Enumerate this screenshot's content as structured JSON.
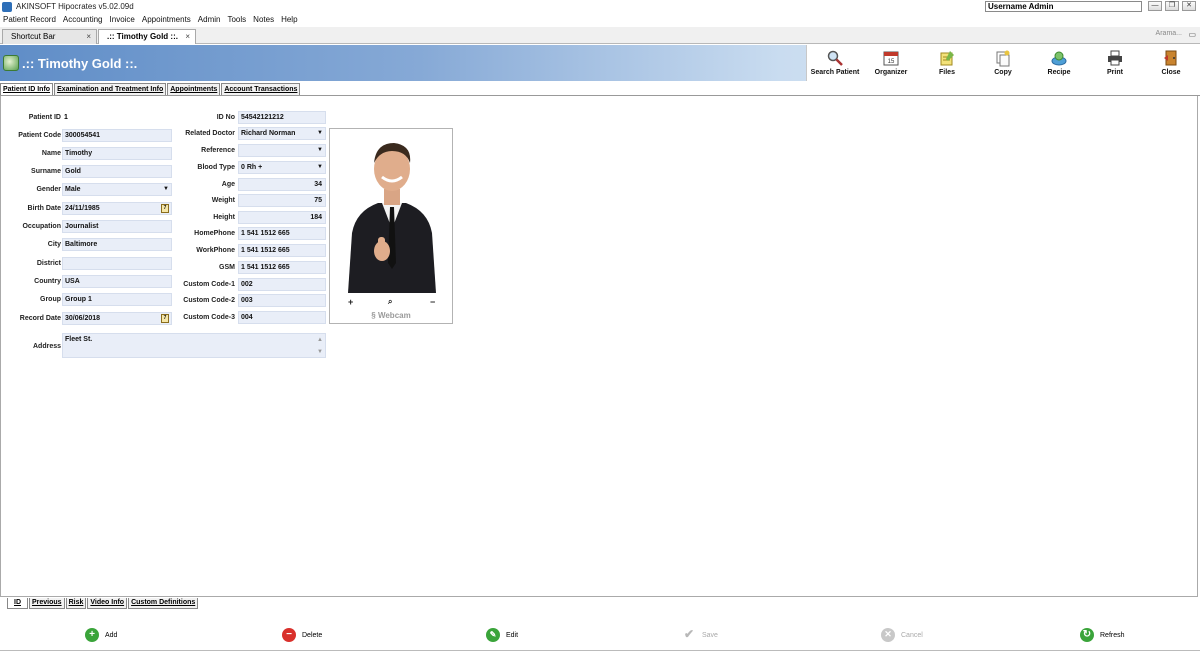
{
  "window": {
    "title": "AKINSOFT Hipocrates v5.02.09d",
    "user": "Username Admin",
    "controls": {
      "minimize": "—",
      "restore": "❐",
      "close": "✕"
    }
  },
  "menu": [
    "Patient Record",
    "Accounting",
    "Invoice",
    "Appointments",
    "Admin",
    "Tools",
    "Notes",
    "Help"
  ],
  "doc_tabs": [
    {
      "label": "Shortcut Bar",
      "close": "×"
    },
    {
      "label": ".:: Timothy Gold ::.",
      "close": "×"
    }
  ],
  "search_hint": "Arama...",
  "header": {
    "title": ".:: Timothy Gold ::."
  },
  "toolbar": [
    "Search Patient",
    "Organizer",
    "Files",
    "Copy",
    "Recipe",
    "Print",
    "Close"
  ],
  "section_tabs": [
    "Patient ID Info",
    "Examination and Treatment Info",
    "Appointments",
    "Account Transactions"
  ],
  "left_fields": {
    "patient_id": {
      "label": "Patient ID",
      "value": "1"
    },
    "patient_code": {
      "label": "Patient Code",
      "value": "300054541"
    },
    "name": {
      "label": "Name",
      "value": "Timothy"
    },
    "surname": {
      "label": "Surname",
      "value": "Gold"
    },
    "gender": {
      "label": "Gender",
      "value": "Male"
    },
    "birth_date": {
      "label": "Birth Date",
      "value": "24/11/1985"
    },
    "occupation": {
      "label": "Occupation",
      "value": "Journalist"
    },
    "city": {
      "label": "City",
      "value": "Baltimore"
    },
    "district": {
      "label": "District",
      "value": ""
    },
    "country": {
      "label": "Country",
      "value": "USA"
    },
    "group": {
      "label": "Group",
      "value": "Group 1"
    },
    "record_date": {
      "label": "Record Date",
      "value": "30/06/2018"
    },
    "address": {
      "label": "Address",
      "value": "Fleet St."
    }
  },
  "right_fields": {
    "id_no": {
      "label": "ID No",
      "value": "54542121212"
    },
    "related_doctor": {
      "label": "Related Doctor",
      "value": "Richard Norman"
    },
    "reference": {
      "label": "Reference",
      "value": ""
    },
    "blood_type": {
      "label": "Blood Type",
      "value": "0 Rh +"
    },
    "age": {
      "label": "Age",
      "value": "34"
    },
    "weight": {
      "label": "Weight",
      "value": "75"
    },
    "height": {
      "label": "Height",
      "value": "184"
    },
    "home_phone": {
      "label": "HomePhone",
      "value": "1 541 1512 665"
    },
    "work_phone": {
      "label": "WorkPhone",
      "value": "1 541 1512 665"
    },
    "gsm": {
      "label": "GSM",
      "value": "1 541 1512 665"
    },
    "custom_code_1": {
      "label": "Custom Code-1",
      "value": "002"
    },
    "custom_code_2": {
      "label": "Custom Code-2",
      "value": "003"
    },
    "custom_code_3": {
      "label": "Custom Code-3",
      "value": "004"
    }
  },
  "photo": {
    "zoom_in": "+",
    "zoom": "⌕",
    "zoom_out": "−",
    "webcam": "Webcam"
  },
  "bottom_tabs": [
    "ID",
    "Previous",
    "Risk",
    "Video Info",
    "Custom Definitions"
  ],
  "actions": {
    "add": "Add",
    "delete": "Delete",
    "edit": "Edit",
    "save": "Save",
    "cancel": "Cancel",
    "refresh": "Refresh"
  },
  "colors": {
    "header_start": "#5f8dc7",
    "field_bg": "#e9eef8",
    "add": "#3aa43a",
    "delete": "#d9302b",
    "disabled": "#a9a9a9"
  }
}
